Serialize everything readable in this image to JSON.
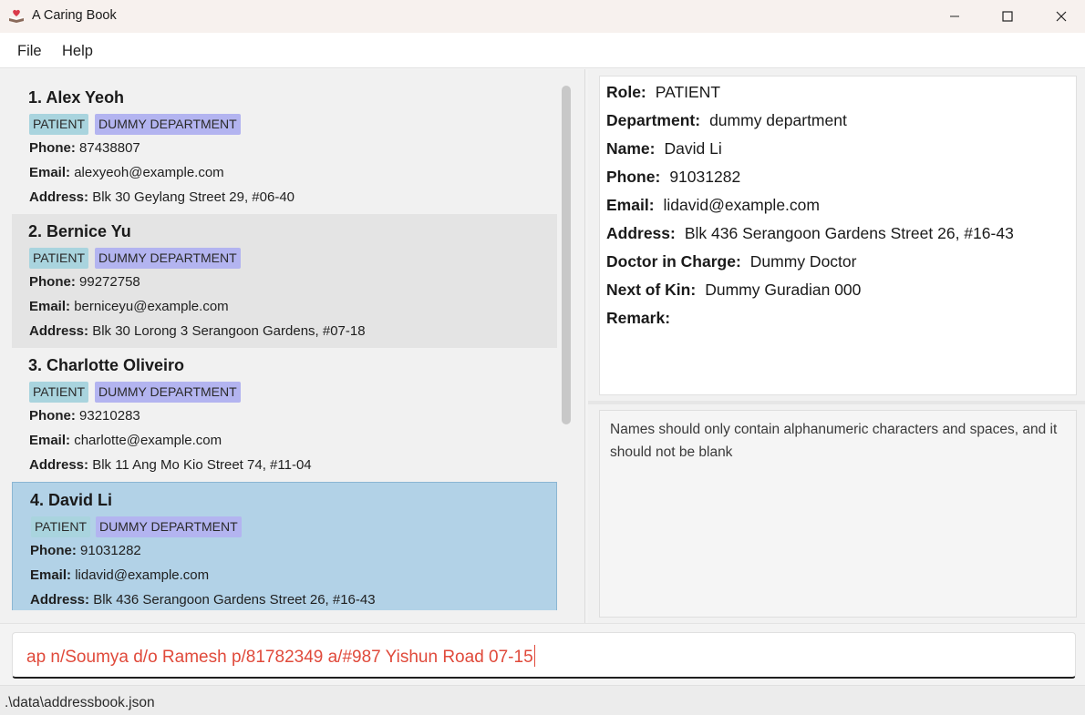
{
  "window": {
    "title": "A Caring Book",
    "icon": "book-heart-icon"
  },
  "menu": {
    "file": "File",
    "help": "Help"
  },
  "labels": {
    "phone": "Phone:",
    "email": "Email:",
    "address": "Address:"
  },
  "persons": [
    {
      "index_name": "1. Alex Yeoh",
      "role": "PATIENT",
      "department": "DUMMY DEPARTMENT",
      "phone": "87438807",
      "email": "alexyeoh@example.com",
      "address": "Blk 30 Geylang Street 29, #06-40"
    },
    {
      "index_name": "2. Bernice Yu",
      "role": "PATIENT",
      "department": "DUMMY DEPARTMENT",
      "phone": "99272758",
      "email": "berniceyu@example.com",
      "address": "Blk 30 Lorong 3 Serangoon Gardens, #07-18"
    },
    {
      "index_name": "3. Charlotte Oliveiro",
      "role": "PATIENT",
      "department": "DUMMY DEPARTMENT",
      "phone": "93210283",
      "email": "charlotte@example.com",
      "address": "Blk 11 Ang Mo Kio Street 74, #11-04"
    },
    {
      "index_name": "4. David Li",
      "role": "PATIENT",
      "department": "DUMMY DEPARTMENT",
      "phone": "91031282",
      "email": "lidavid@example.com",
      "address": "Blk 436 Serangoon Gardens Street 26, #16-43"
    }
  ],
  "detail": {
    "role_label": "Role:",
    "role": "PATIENT",
    "department_label": "Department:",
    "department": "dummy department",
    "name_label": "Name:",
    "name": "David Li",
    "phone_label": "Phone:",
    "phone": "91031282",
    "email_label": "Email:",
    "email": "lidavid@example.com",
    "address_label": "Address:",
    "address": "Blk 436 Serangoon Gardens Street 26, #16-43",
    "doctor_label": "Doctor in Charge:",
    "doctor": "Dummy Doctor",
    "kin_label": "Next of Kin:",
    "kin": "Dummy Guradian 000",
    "remark_label": "Remark:",
    "remark": ""
  },
  "result": {
    "message": "Names should only contain alphanumeric characters and spaces, and it should not be blank"
  },
  "command": {
    "value": "ap n/Soumya d/o Ramesh p/81782349 a/#987 Yishun Road 07-15"
  },
  "status": {
    "path": ".\\data\\addressbook.json"
  },
  "colors": {
    "selected_card": "#b2d2e7",
    "role_tag": "#a9d4de",
    "department_tag": "#b3b4f0",
    "command_error_text": "#e04a3b"
  }
}
